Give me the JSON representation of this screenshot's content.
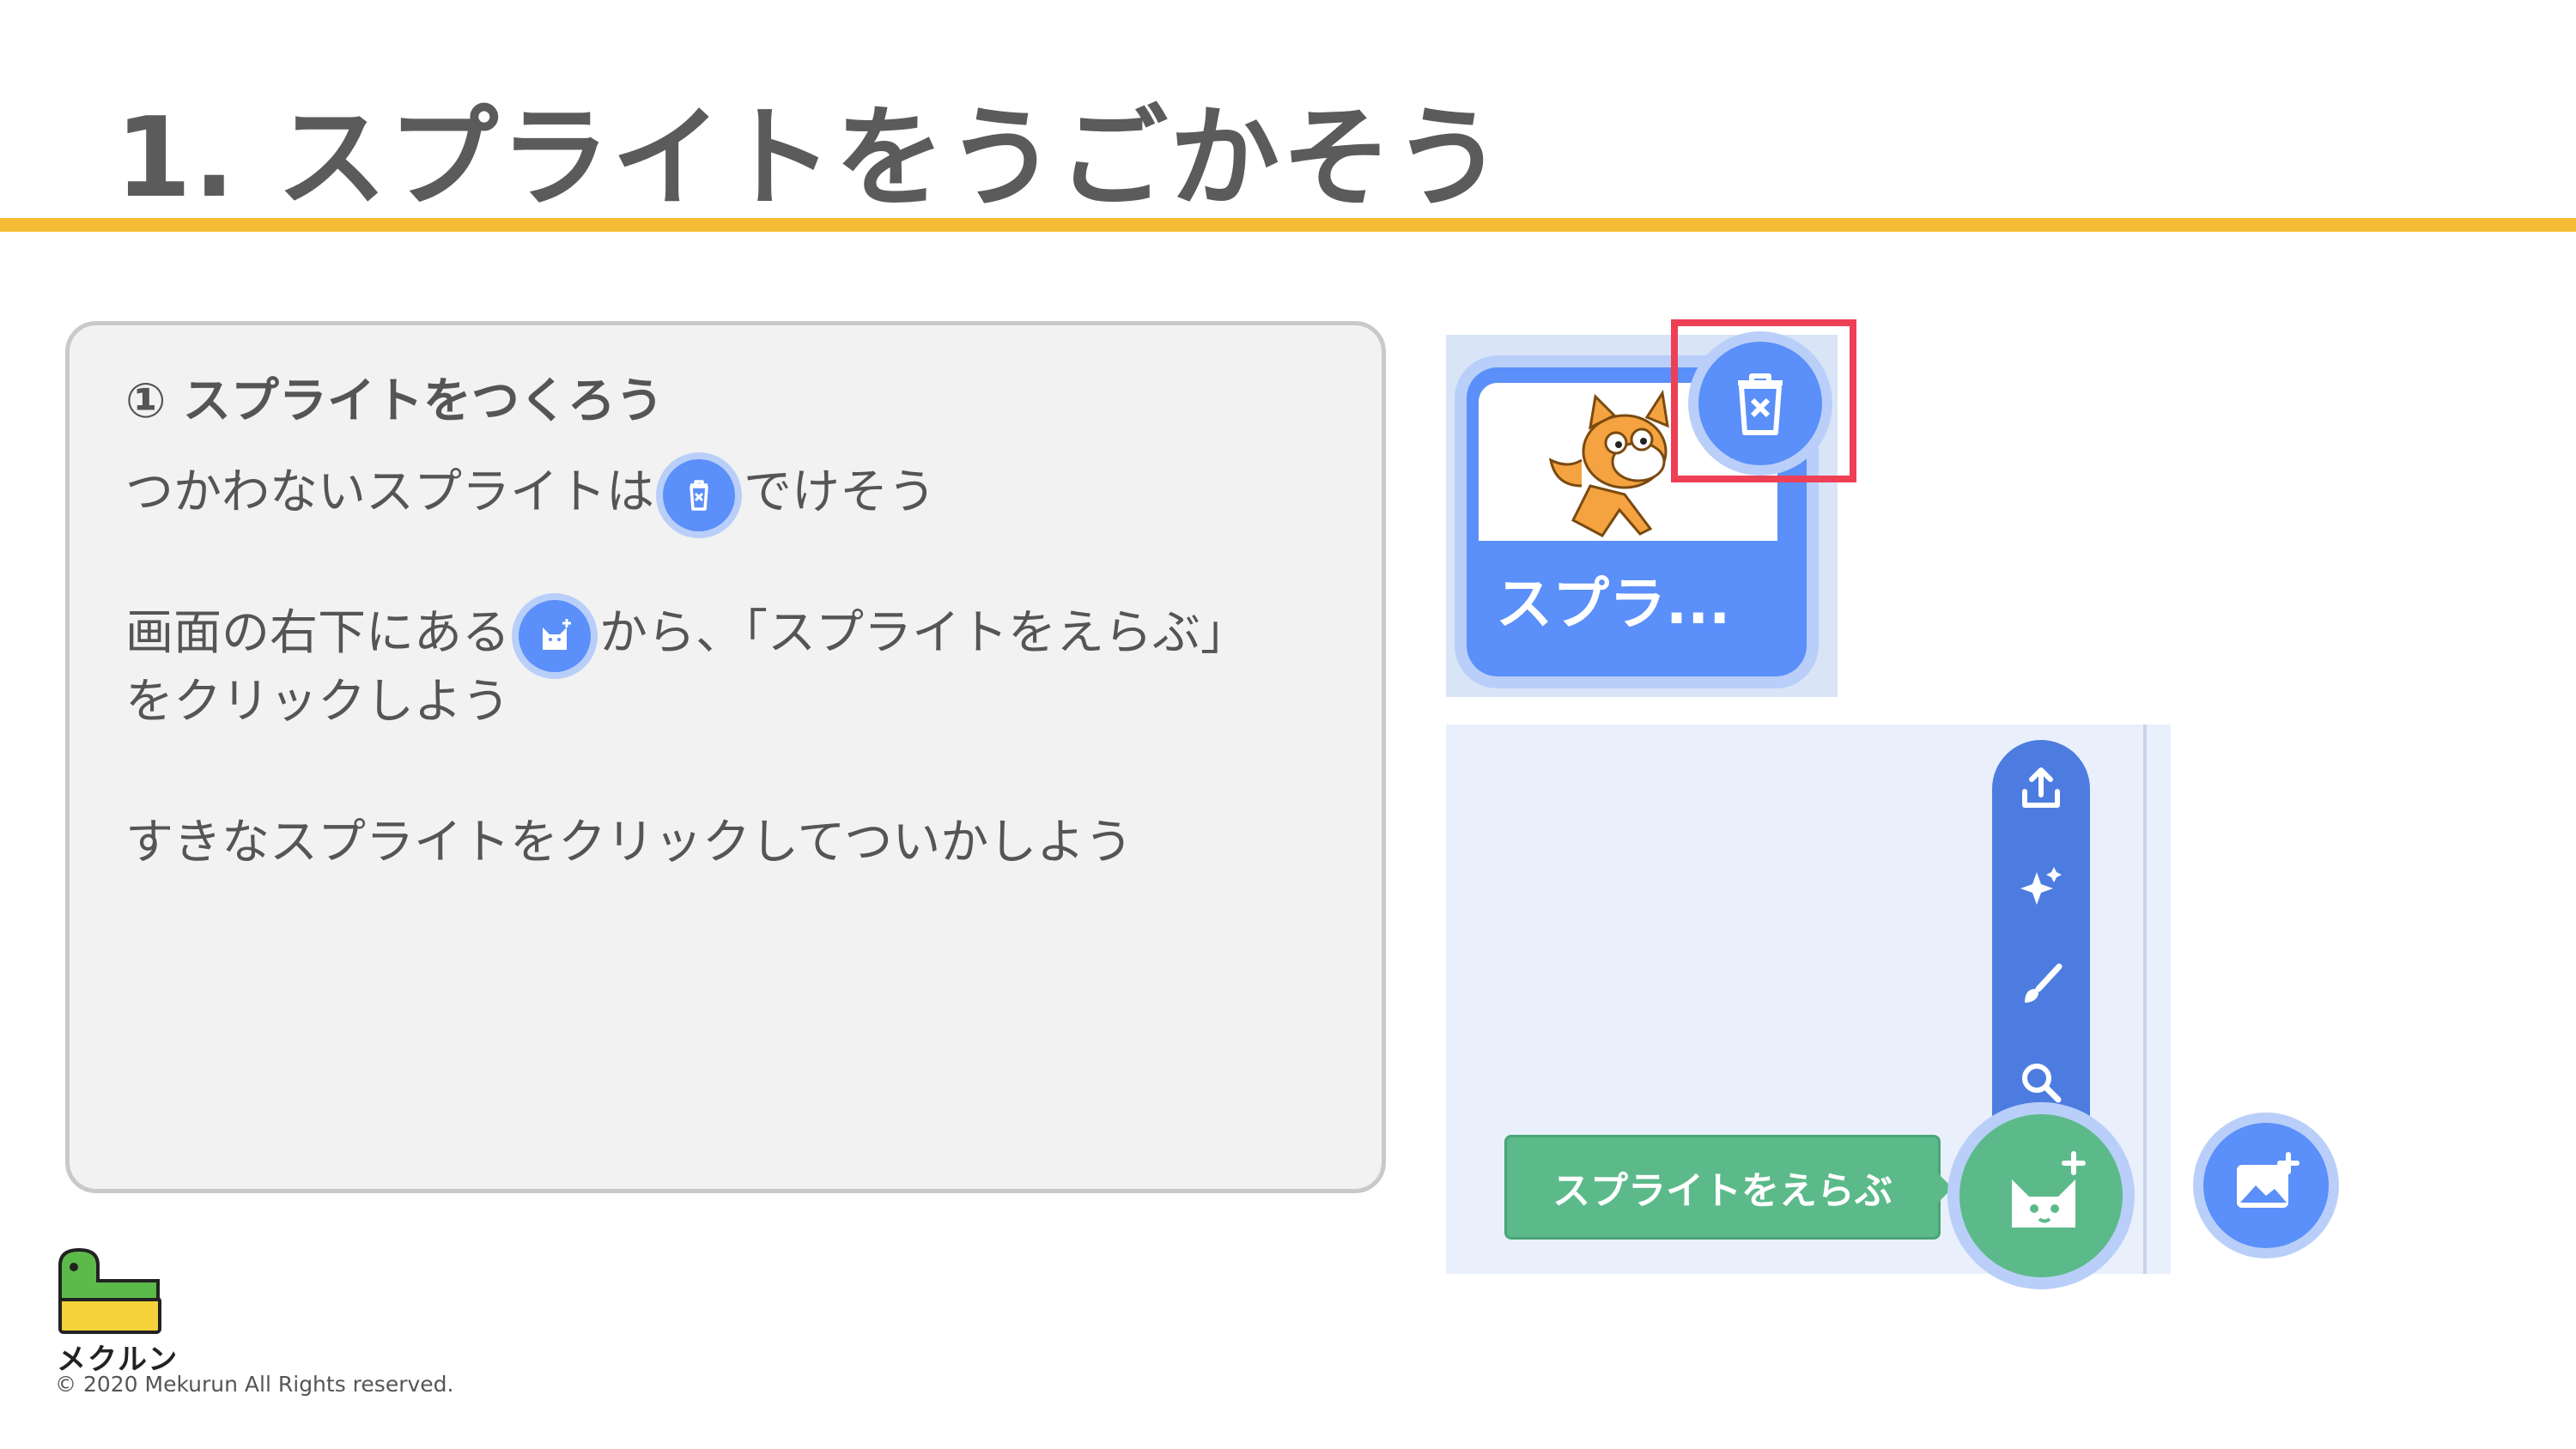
{
  "title": "1. スプライトをうごかそう",
  "card": {
    "step_heading": "① スプライトをつくろう",
    "line1_before": "つかわないスプライトは",
    "line1_after": "でけそう",
    "line2_before": "画面の右下にある",
    "line2_after": "から、「スプライトをえらぶ」",
    "line3": "をクリックしよう",
    "line4": "すきなスプライトをクリックしてついかしよう"
  },
  "sprite_tile": {
    "label": "スプラ..."
  },
  "panel": {
    "tooltip": "スプライトをえらぶ",
    "menu_icons": [
      "upload-icon",
      "surprise-icon",
      "paint-icon",
      "search-icon"
    ]
  },
  "footer": {
    "logo_text": "メクルン",
    "copyright": "© 2020 Mekurun All Rights reserved."
  },
  "colors": {
    "accent_yellow": "#f6bb35",
    "scratch_blue": "#5b8ff9",
    "scratch_green": "#5cba8a",
    "highlight_red": "#ee3f55"
  }
}
